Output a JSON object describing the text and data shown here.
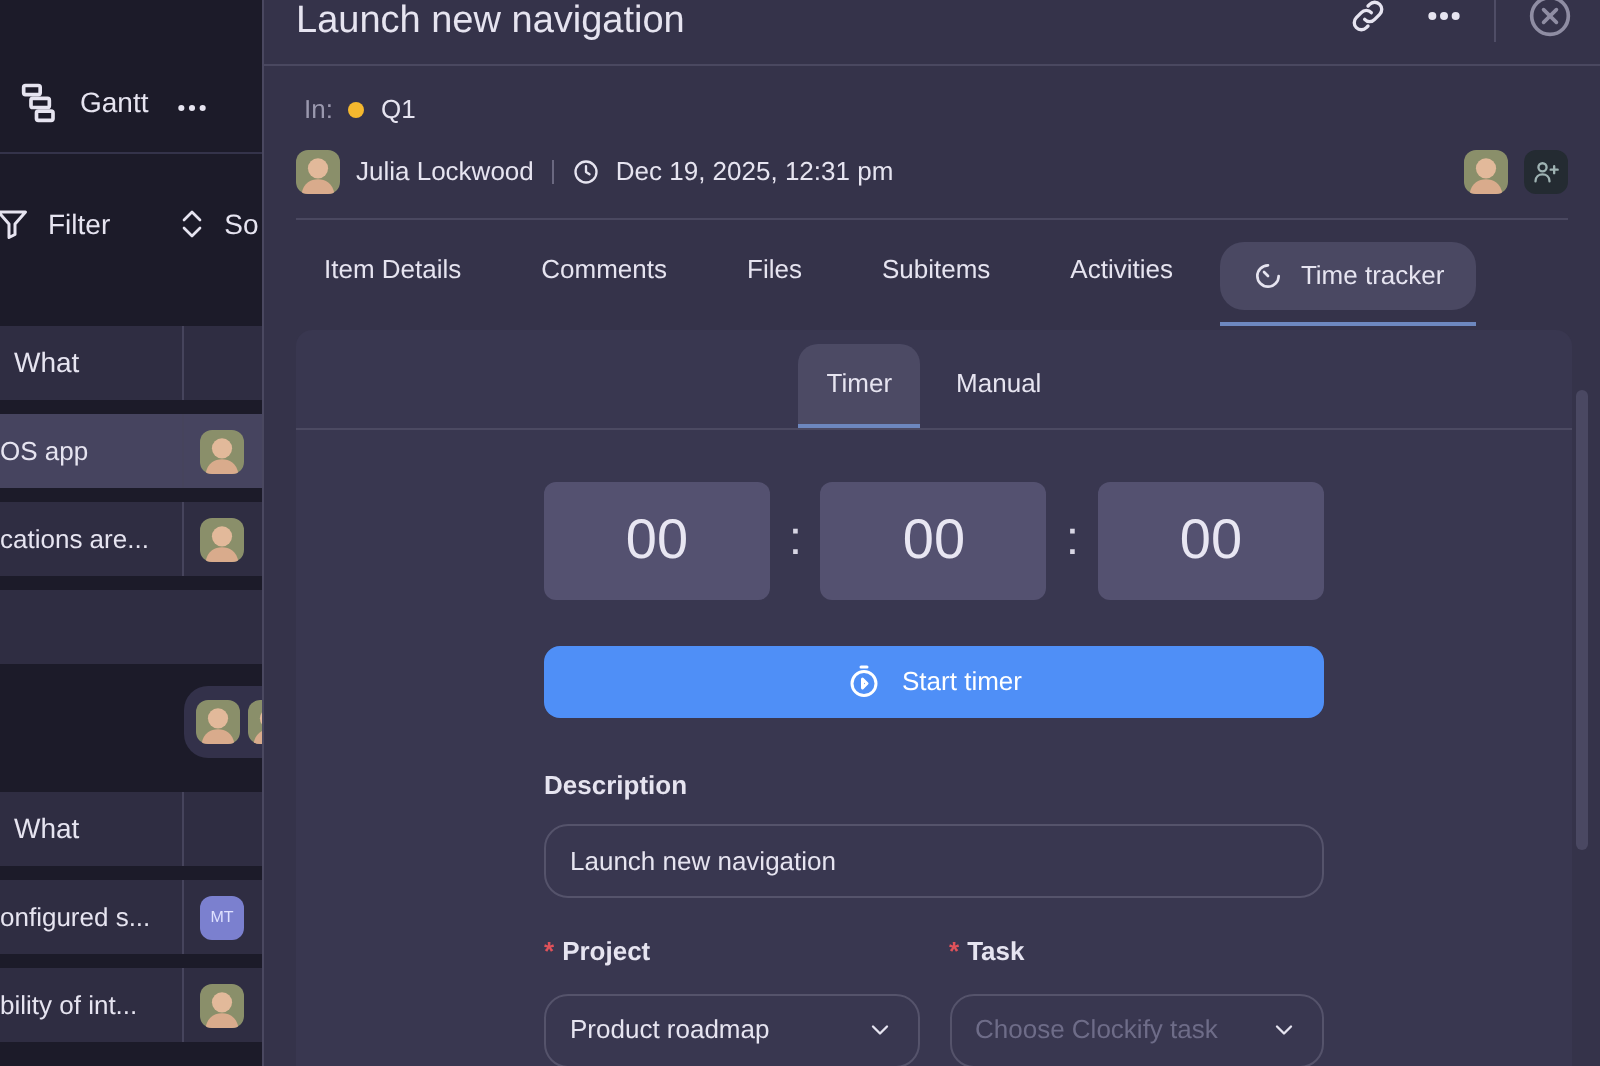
{
  "board": {
    "view": {
      "label": "Gantt"
    },
    "filter": "Filter",
    "sort": "So",
    "groups": [
      {
        "header": "What",
        "rows": [
          {
            "text": "OS app",
            "selected": true,
            "assignee": {
              "kind": "photo"
            }
          },
          {
            "text": "cations are...",
            "selected": false,
            "assignee": {
              "kind": "photo"
            }
          }
        ],
        "footer_assignees": [
          {
            "kind": "photo"
          },
          {
            "kind": "photo"
          }
        ]
      },
      {
        "header": "What",
        "rows": [
          {
            "text": "onfigured s...",
            "selected": false,
            "assignee": {
              "kind": "initials",
              "initials": "MT"
            }
          },
          {
            "text": "bility of int...",
            "selected": false,
            "assignee": {
              "kind": "photo"
            }
          }
        ]
      }
    ]
  },
  "drawer": {
    "title": "Launch new navigation",
    "location_prefix": "In:",
    "location": {
      "name": "Q1",
      "color": "#f5b82e"
    },
    "author": "Julia Lockwood",
    "created": "Dec 19, 2025, 12:31 pm",
    "tabs": [
      {
        "label": "Item Details",
        "selected": false,
        "kind": "text"
      },
      {
        "label": "Comments",
        "selected": false,
        "kind": "text"
      },
      {
        "label": "Files",
        "selected": false,
        "kind": "text"
      },
      {
        "label": "Subitems",
        "selected": false,
        "kind": "text"
      },
      {
        "label": "Activities",
        "selected": false,
        "kind": "text"
      },
      {
        "label": "Time tracker",
        "selected": true,
        "kind": "timer"
      }
    ],
    "tracker": {
      "modes": [
        {
          "label": "Timer",
          "selected": true
        },
        {
          "label": "Manual",
          "selected": false
        }
      ],
      "time": [
        "00",
        "00",
        "00"
      ],
      "separator": ":",
      "start_button": "Start timer",
      "description": {
        "label": "Description",
        "value": "Launch new navigation"
      },
      "project": {
        "label": "Project",
        "required_mark": "*",
        "value": "Product roadmap"
      },
      "task": {
        "label": "Task",
        "required_mark": "*",
        "placeholder": "Choose Clockify task"
      }
    }
  }
}
